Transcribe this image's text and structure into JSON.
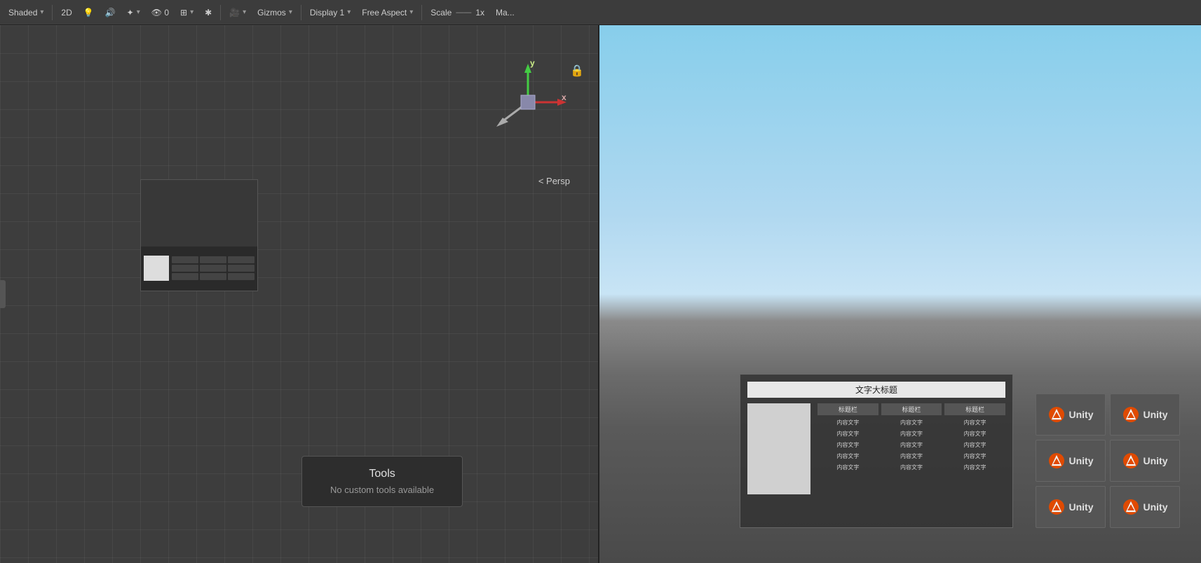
{
  "toolbar": {
    "shading_label": "Shaded",
    "shading_arrow": "▾",
    "2d_label": "2D",
    "audio_icon": "🔊",
    "visibility_label": "👁 0",
    "grid_icon": "⊞",
    "tools_icon": "✱",
    "camera_icon": "📷",
    "gizmos_label": "Gizmos",
    "gizmos_arrow": "▾",
    "display_label": "Display 1",
    "display_arrow": "▾",
    "aspect_label": "Free Aspect",
    "aspect_arrow": "▾",
    "scale_label": "Scale",
    "scale_value": "1x",
    "max_label": "Ma..."
  },
  "scene": {
    "persp_label": "< Persp",
    "y_axis": "y",
    "x_axis": "x"
  },
  "tools_tooltip": {
    "title": "Tools",
    "subtitle": "No custom tools available"
  },
  "ui_canvas": {
    "title": "文字大标题",
    "headers": [
      "标题栏",
      "标题栏",
      "标题栏"
    ],
    "rows": [
      [
        "内容文字",
        "内容文字",
        "内容文字"
      ],
      [
        "内容文字",
        "内容文字",
        "内容文字"
      ],
      [
        "内容文字",
        "内容文字",
        "内容文字"
      ],
      [
        "内容文字",
        "内容文字",
        "内容文字"
      ],
      [
        "内容文字",
        "内容文字",
        "内容文字"
      ]
    ]
  },
  "unity_buttons": [
    {
      "label": "Unity"
    },
    {
      "label": "Unity"
    },
    {
      "label": "Unity"
    },
    {
      "label": "Unity"
    },
    {
      "label": "Unity"
    },
    {
      "label": "Unity"
    }
  ]
}
